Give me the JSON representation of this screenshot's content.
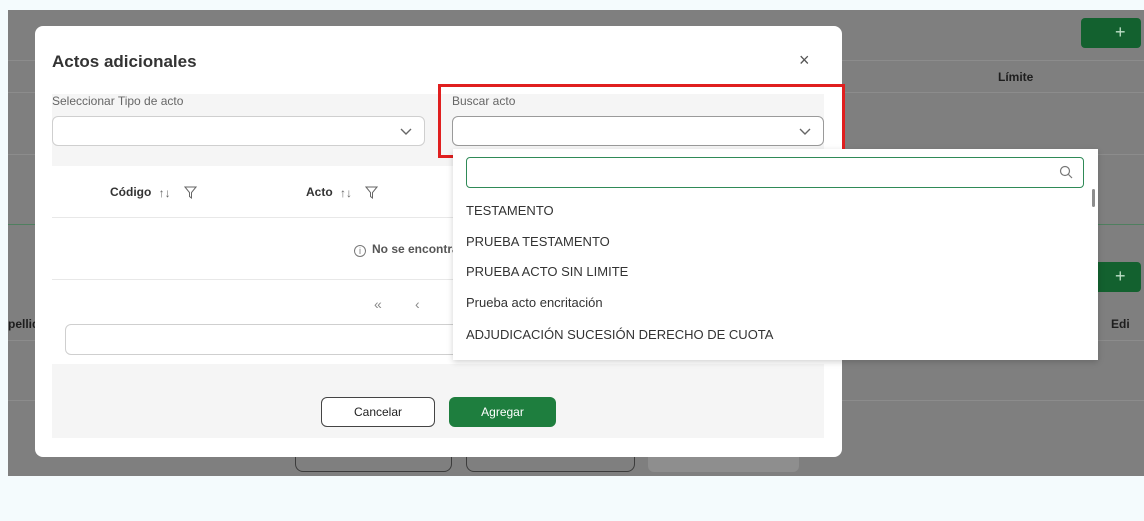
{
  "background": {
    "limit_header": "Límite",
    "apellido_header": "pellid",
    "edit_header": "Edi",
    "add_button_glyph": "+"
  },
  "modal": {
    "title": "Actos adicionales",
    "close_glyph": "×",
    "tipo_label": "Seleccionar Tipo de acto",
    "buscar_label": "Buscar acto",
    "table": {
      "columns": [
        {
          "label": "Código",
          "sort_glyph": "↑↓"
        },
        {
          "label": "Acto",
          "sort_glyph": "↑↓"
        }
      ],
      "empty_message": "No se encontra",
      "info_glyph": "i"
    },
    "pager": {
      "first_glyph": "«",
      "prev_glyph": "‹"
    },
    "cancel_label": "Cancelar",
    "add_label": "Agregar"
  },
  "dropdown": {
    "search_placeholder": "",
    "items": [
      "TESTAMENTO",
      "PRUEBA TESTAMENTO",
      "PRUEBA ACTO SIN LIMITE",
      "Prueba acto encritación",
      "ADJUDICACIÓN SUCESIÓN DERECHO DE CUOTA"
    ]
  },
  "colors": {
    "primary_green": "#1e7e3e",
    "highlight_red": "#e01f1f",
    "overlay_grey": "#7f7f7f"
  }
}
